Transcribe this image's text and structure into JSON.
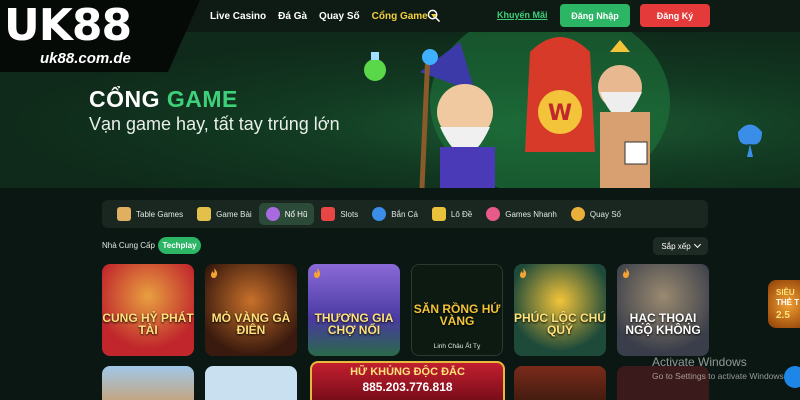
{
  "logo": {
    "brand": "UK88",
    "domain": "uk88.com.de"
  },
  "nav": [
    {
      "label": "Live Casino",
      "active": false
    },
    {
      "label": "Đá Gà",
      "active": false
    },
    {
      "label": "Quay Số",
      "active": false
    },
    {
      "label": "Cổng Game",
      "active": true
    }
  ],
  "header": {
    "promo_label": "Khuyến Mãi",
    "login_label": "Đăng Nhập",
    "register_label": "Đăng Ký"
  },
  "banner": {
    "title_main": "CỔNG",
    "title_accent": "GAME",
    "subtitle": "Vạn game hay, tất tay trúng lớn"
  },
  "categories": [
    {
      "label": "Table Games",
      "icon": "dice-icon",
      "color": "#e0b060",
      "active": false
    },
    {
      "label": "Game Bài",
      "icon": "cards-icon",
      "color": "#e3c04a",
      "active": false
    },
    {
      "label": "Nổ Hũ",
      "icon": "jar-icon",
      "color": "#a96ae0",
      "active": true
    },
    {
      "label": "Slots",
      "icon": "seven-icon",
      "color": "#e84545",
      "active": false
    },
    {
      "label": "Bắn Cá",
      "icon": "fish-icon",
      "color": "#3a8ee8",
      "active": false
    },
    {
      "label": "Lô Đề",
      "icon": "ticket-icon",
      "color": "#e8c23a",
      "active": false
    },
    {
      "label": "Games Nhanh",
      "icon": "rocket-icon",
      "color": "#e85a8a",
      "active": false
    },
    {
      "label": "Quay Số",
      "icon": "coin-icon",
      "color": "#e8b03a",
      "active": false
    }
  ],
  "provider": {
    "label": "Nhà Cung Cấp",
    "selected": "Techplay"
  },
  "sort": {
    "label": "Sắp xếp"
  },
  "games": [
    {
      "title": "CUNG HỶ PHÁT TÀI",
      "bg": "#c0262c",
      "hot": false,
      "caption": ""
    },
    {
      "title": "MỎ VÀNG GÀ ĐIÊN",
      "bg": "#6a2a1a",
      "hot": true,
      "caption": ""
    },
    {
      "title": "THƯƠNG GIA CHỢ NỔI",
      "bg": "#4a3aa0",
      "hot": true,
      "caption": ""
    },
    {
      "title": "SĂN RỒNG HỨ VÀNG",
      "bg": "#0d1a12",
      "hot": false,
      "caption": "Linh Châu Ất Tỵ"
    },
    {
      "title": "PHÚC LỘC CHÚ QUÝ",
      "bg": "#1e4a3a",
      "hot": true,
      "caption": ""
    },
    {
      "title": "HẠC THOẠI NGỘ KHÔNG",
      "bg": "#3a3e4a",
      "hot": true,
      "caption": ""
    }
  ],
  "jackpot": {
    "title": "HỮ KHỦNG ĐỘC ĐẮC",
    "value": "885.203.776.818"
  },
  "side_promo": {
    "line1": "SIÊU",
    "line2": "THẺ T",
    "line3": "2.5"
  },
  "watermark": {
    "title": "Activate Windows",
    "subtitle": "Go to Settings to activate Windows."
  }
}
